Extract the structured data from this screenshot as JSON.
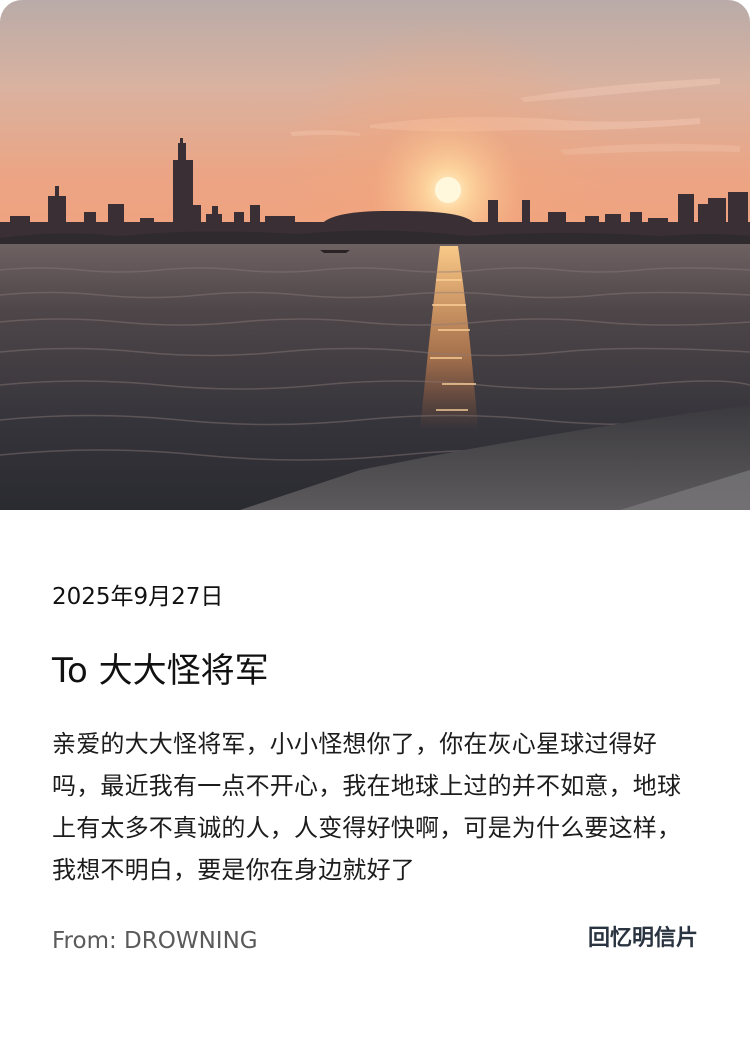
{
  "postcard": {
    "photo_description": "sunset over lake with city skyline",
    "date": "2025年9月27日",
    "title": "To 大大怪将军",
    "body": "亲爱的大大怪将军，小小怪想你了，你在灰心星球过得好吗，最近我有一点不开心，我在地球上过的并不如意，地球上有太多不真诚的人，人变得好快啊，可是为什么要这样，我想不明白，要是你在身边就好了",
    "from": "From: DROWNING",
    "recall_label": "回忆明信片"
  },
  "colors": {
    "sky_top": "#c9b6aa",
    "sky_mid": "#e8a98a",
    "sun": "#fff3c8",
    "water": "#3d3b40",
    "recall_text": "#2a3340"
  }
}
